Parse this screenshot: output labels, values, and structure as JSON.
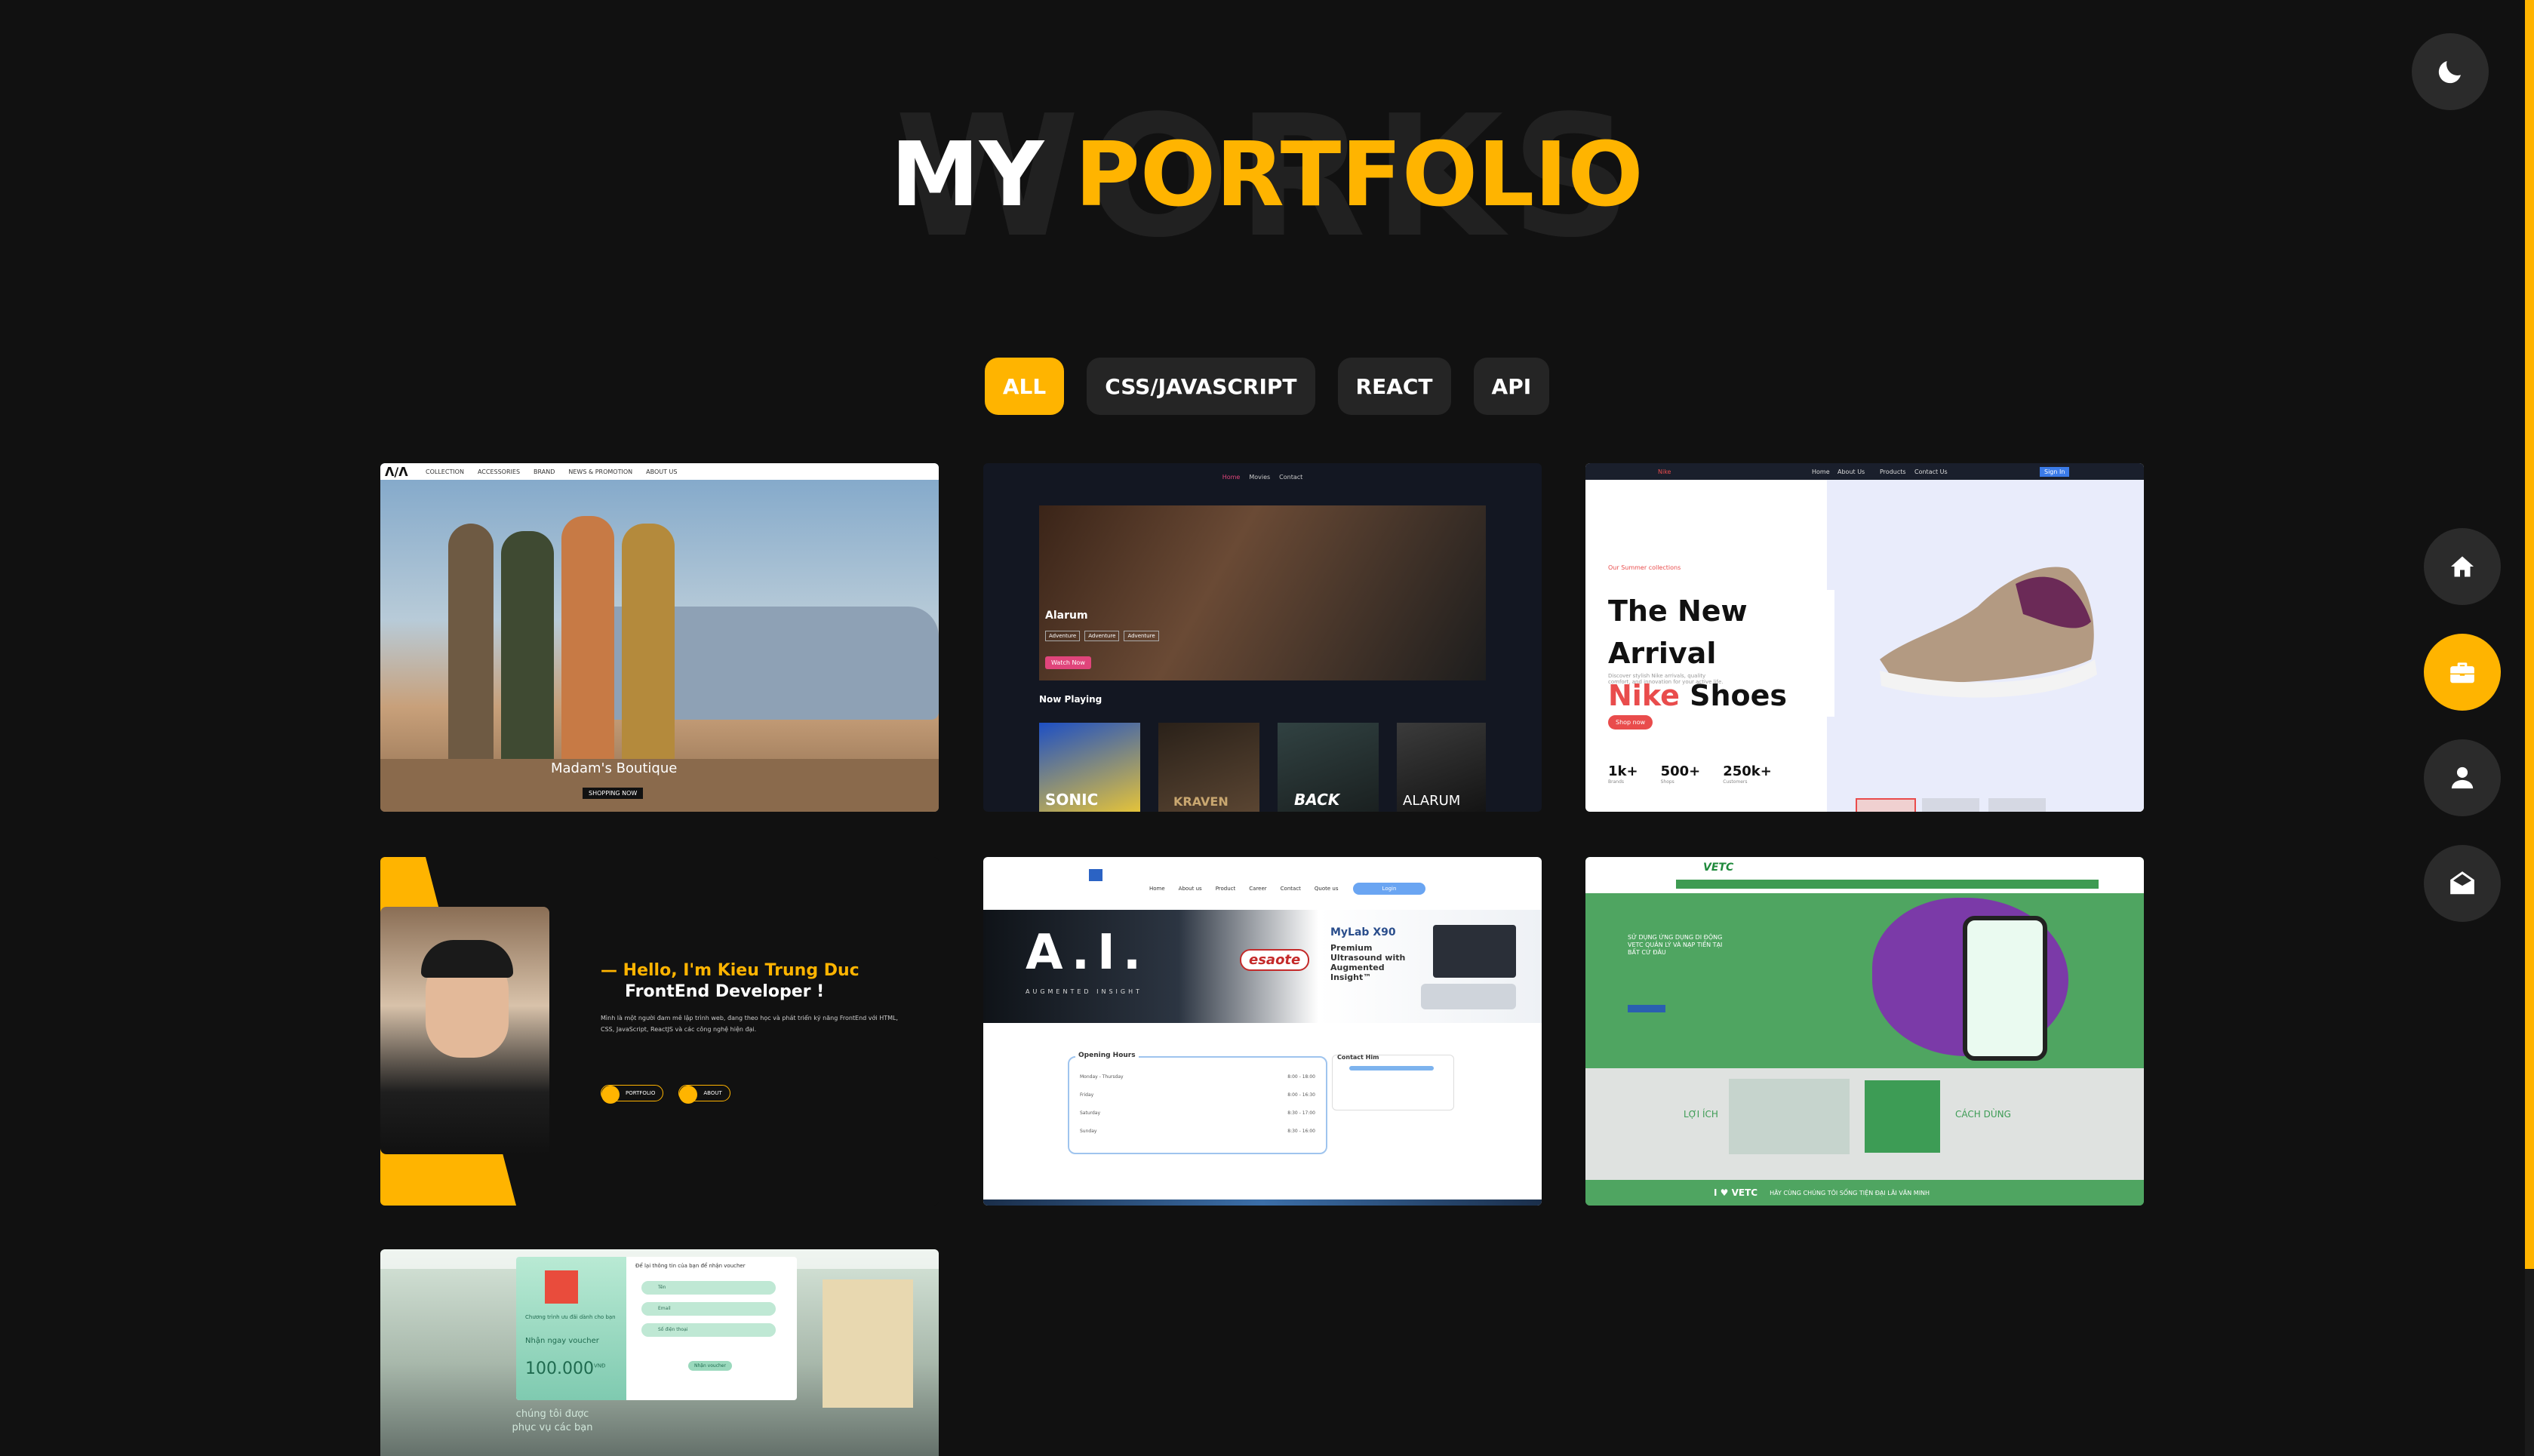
{
  "heading": {
    "background_word": "WORKS",
    "title_white": "MY",
    "title_accent": "PORTFOLIO"
  },
  "filters": [
    {
      "label": "ALL",
      "active": true
    },
    {
      "label": "CSS/JAVASCRIPT",
      "active": false
    },
    {
      "label": "REACT",
      "active": false
    },
    {
      "label": "API",
      "active": false
    }
  ],
  "side_nav": [
    "home-icon",
    "briefcase-icon",
    "user-icon",
    "envelope-open-icon"
  ],
  "theme_toggle": "moon-icon",
  "colors": {
    "accent": "#ffb400",
    "background": "#111111",
    "button": "#252525"
  },
  "projects": [
    {
      "name": "madams-boutique",
      "nav": [
        "COLLECTION",
        "ACCESSORIES",
        "BRAND",
        "NEWS & PROMOTION",
        "ABOUT US"
      ],
      "caption": "Madam's Boutique",
      "cta": "SHOPPING NOW"
    },
    {
      "name": "movie-site",
      "nav": [
        "Home",
        "Movies",
        "Contact"
      ],
      "feature_title": "Alarum",
      "tags": [
        "Adventure",
        "Adventure",
        "Adventure"
      ],
      "cta": "Watch Now",
      "section": "Now Playing",
      "posters": [
        "SONIC",
        "KRAVEN",
        "BACK",
        "ALARUM"
      ]
    },
    {
      "name": "nike-store",
      "brand": "Nike",
      "nav": [
        "Home",
        "About Us",
        "Products",
        "Contact Us"
      ],
      "signin": "Sign In",
      "eyebrow": "Our Summer collections",
      "heading_line1": "The New Arrival",
      "heading_accent": "Nike",
      "heading_line2": "Shoes",
      "description": "Discover stylish Nike arrivals, quality comfort, and innovation for your active life.",
      "cta": "Shop now",
      "stats": [
        {
          "value": "1k+",
          "label": "Brands"
        },
        {
          "value": "500+",
          "label": "Shops"
        },
        {
          "value": "250k+",
          "label": "Customers"
        }
      ]
    },
    {
      "name": "personal-portfolio",
      "greeting": "Hello, I'm Kieu Trung Duc",
      "role": "FrontEnd Developer !",
      "bio": "Mình là một người đam mê lập trình web, đang theo học và phát triển kỹ năng FrontEnd với HTML, CSS, JavaScript, ReactJS và các công nghệ hiện đại.",
      "buttons": [
        "PORTFOLIO",
        "ABOUT"
      ]
    },
    {
      "name": "medical-site",
      "nav": [
        "Home",
        "About us",
        "Product",
        "Career",
        "Contact",
        "Quote us"
      ],
      "login": "Login",
      "hero_text": "A.I.",
      "hero_sub": "AUGMENTED INSIGHT",
      "brand": "esaote",
      "product": "MyLab X90",
      "product_desc": "Premium Ultrasound with Augmented Insight™",
      "hours_title": "Opening Hours",
      "hours": [
        {
          "day": "Monday - Thursday",
          "time": "8:00 - 18:00"
        },
        {
          "day": "Friday",
          "time": "8:00 - 16:30"
        },
        {
          "day": "Saturday",
          "time": "8:30 - 17:00"
        },
        {
          "day": "Sunday",
          "time": "8:30 - 16:00"
        }
      ],
      "contact_title": "Contact Him"
    },
    {
      "name": "vetc-site",
      "brand": "VETC",
      "headline": "SỬ DỤNG ỨNG DỤNG DI ĐỘNG VETC QUẢN LÝ VÀ NẠP TIỀN TẠI BẤT CỨ ĐÂU",
      "left_label": "LỢI ÍCH",
      "right_label": "CÁCH DÙNG",
      "footer_brand": "I ♥ VETC",
      "footer_text": "HÃY CÙNG CHÚNG TÔI SỐNG TIỆN ĐẠI LÃI VĂN MINH"
    },
    {
      "name": "dental-voucher",
      "popup_title": "Để lại thông tin của bạn để nhận voucher",
      "promo_line": "Chương trình ưu đãi dành cho bạn",
      "voucher_label": "Nhận ngay voucher",
      "voucher_value": "100.000",
      "currency": "VNĐ",
      "fields": [
        "Tên",
        "Email",
        "Số điện thoại"
      ],
      "cta": "Nhận voucher",
      "background_text": "chúng tôi được phục vụ các bạn"
    }
  ]
}
